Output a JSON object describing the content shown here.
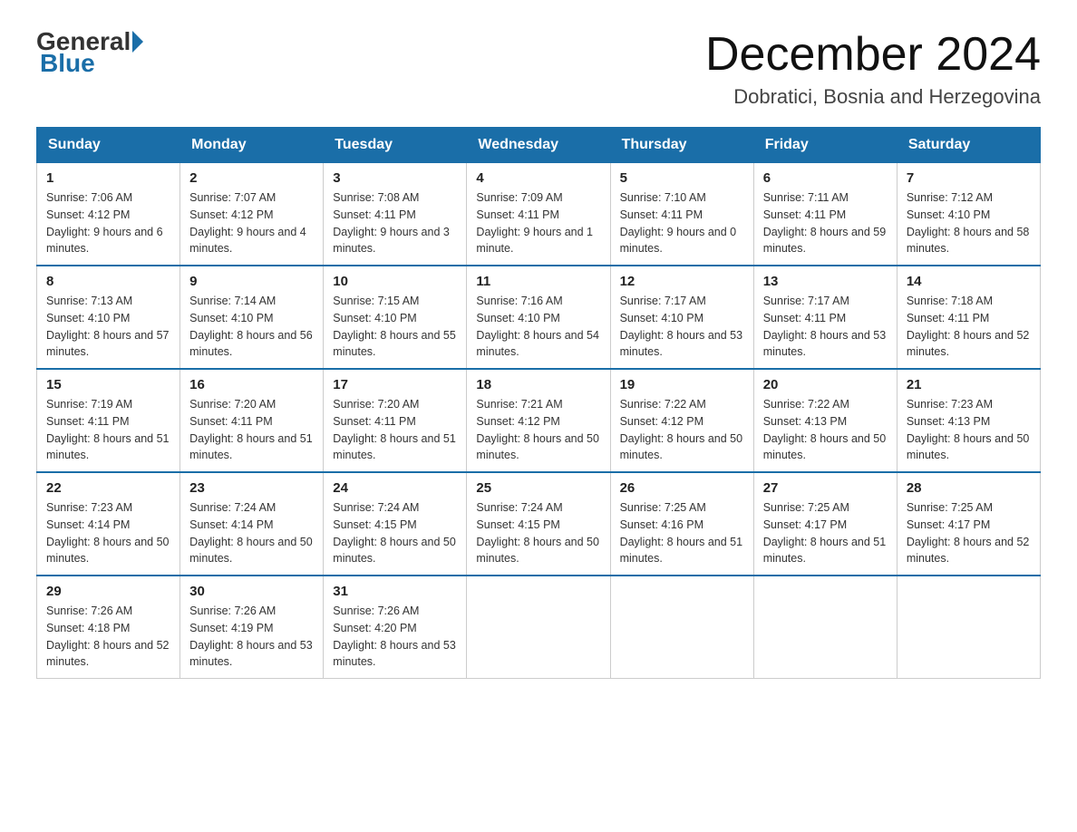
{
  "header": {
    "logo_general": "General",
    "logo_blue": "Blue",
    "month_title": "December 2024",
    "location": "Dobratici, Bosnia and Herzegovina"
  },
  "days_of_week": [
    "Sunday",
    "Monday",
    "Tuesday",
    "Wednesday",
    "Thursday",
    "Friday",
    "Saturday"
  ],
  "weeks": [
    [
      {
        "day": "1",
        "sunrise": "7:06 AM",
        "sunset": "4:12 PM",
        "daylight": "9 hours and 6 minutes."
      },
      {
        "day": "2",
        "sunrise": "7:07 AM",
        "sunset": "4:12 PM",
        "daylight": "9 hours and 4 minutes."
      },
      {
        "day": "3",
        "sunrise": "7:08 AM",
        "sunset": "4:11 PM",
        "daylight": "9 hours and 3 minutes."
      },
      {
        "day": "4",
        "sunrise": "7:09 AM",
        "sunset": "4:11 PM",
        "daylight": "9 hours and 1 minute."
      },
      {
        "day": "5",
        "sunrise": "7:10 AM",
        "sunset": "4:11 PM",
        "daylight": "9 hours and 0 minutes."
      },
      {
        "day": "6",
        "sunrise": "7:11 AM",
        "sunset": "4:11 PM",
        "daylight": "8 hours and 59 minutes."
      },
      {
        "day": "7",
        "sunrise": "7:12 AM",
        "sunset": "4:10 PM",
        "daylight": "8 hours and 58 minutes."
      }
    ],
    [
      {
        "day": "8",
        "sunrise": "7:13 AM",
        "sunset": "4:10 PM",
        "daylight": "8 hours and 57 minutes."
      },
      {
        "day": "9",
        "sunrise": "7:14 AM",
        "sunset": "4:10 PM",
        "daylight": "8 hours and 56 minutes."
      },
      {
        "day": "10",
        "sunrise": "7:15 AM",
        "sunset": "4:10 PM",
        "daylight": "8 hours and 55 minutes."
      },
      {
        "day": "11",
        "sunrise": "7:16 AM",
        "sunset": "4:10 PM",
        "daylight": "8 hours and 54 minutes."
      },
      {
        "day": "12",
        "sunrise": "7:17 AM",
        "sunset": "4:10 PM",
        "daylight": "8 hours and 53 minutes."
      },
      {
        "day": "13",
        "sunrise": "7:17 AM",
        "sunset": "4:11 PM",
        "daylight": "8 hours and 53 minutes."
      },
      {
        "day": "14",
        "sunrise": "7:18 AM",
        "sunset": "4:11 PM",
        "daylight": "8 hours and 52 minutes."
      }
    ],
    [
      {
        "day": "15",
        "sunrise": "7:19 AM",
        "sunset": "4:11 PM",
        "daylight": "8 hours and 51 minutes."
      },
      {
        "day": "16",
        "sunrise": "7:20 AM",
        "sunset": "4:11 PM",
        "daylight": "8 hours and 51 minutes."
      },
      {
        "day": "17",
        "sunrise": "7:20 AM",
        "sunset": "4:11 PM",
        "daylight": "8 hours and 51 minutes."
      },
      {
        "day": "18",
        "sunrise": "7:21 AM",
        "sunset": "4:12 PM",
        "daylight": "8 hours and 50 minutes."
      },
      {
        "day": "19",
        "sunrise": "7:22 AM",
        "sunset": "4:12 PM",
        "daylight": "8 hours and 50 minutes."
      },
      {
        "day": "20",
        "sunrise": "7:22 AM",
        "sunset": "4:13 PM",
        "daylight": "8 hours and 50 minutes."
      },
      {
        "day": "21",
        "sunrise": "7:23 AM",
        "sunset": "4:13 PM",
        "daylight": "8 hours and 50 minutes."
      }
    ],
    [
      {
        "day": "22",
        "sunrise": "7:23 AM",
        "sunset": "4:14 PM",
        "daylight": "8 hours and 50 minutes."
      },
      {
        "day": "23",
        "sunrise": "7:24 AM",
        "sunset": "4:14 PM",
        "daylight": "8 hours and 50 minutes."
      },
      {
        "day": "24",
        "sunrise": "7:24 AM",
        "sunset": "4:15 PM",
        "daylight": "8 hours and 50 minutes."
      },
      {
        "day": "25",
        "sunrise": "7:24 AM",
        "sunset": "4:15 PM",
        "daylight": "8 hours and 50 minutes."
      },
      {
        "day": "26",
        "sunrise": "7:25 AM",
        "sunset": "4:16 PM",
        "daylight": "8 hours and 51 minutes."
      },
      {
        "day": "27",
        "sunrise": "7:25 AM",
        "sunset": "4:17 PM",
        "daylight": "8 hours and 51 minutes."
      },
      {
        "day": "28",
        "sunrise": "7:25 AM",
        "sunset": "4:17 PM",
        "daylight": "8 hours and 52 minutes."
      }
    ],
    [
      {
        "day": "29",
        "sunrise": "7:26 AM",
        "sunset": "4:18 PM",
        "daylight": "8 hours and 52 minutes."
      },
      {
        "day": "30",
        "sunrise": "7:26 AM",
        "sunset": "4:19 PM",
        "daylight": "8 hours and 53 minutes."
      },
      {
        "day": "31",
        "sunrise": "7:26 AM",
        "sunset": "4:20 PM",
        "daylight": "8 hours and 53 minutes."
      },
      null,
      null,
      null,
      null
    ]
  ]
}
